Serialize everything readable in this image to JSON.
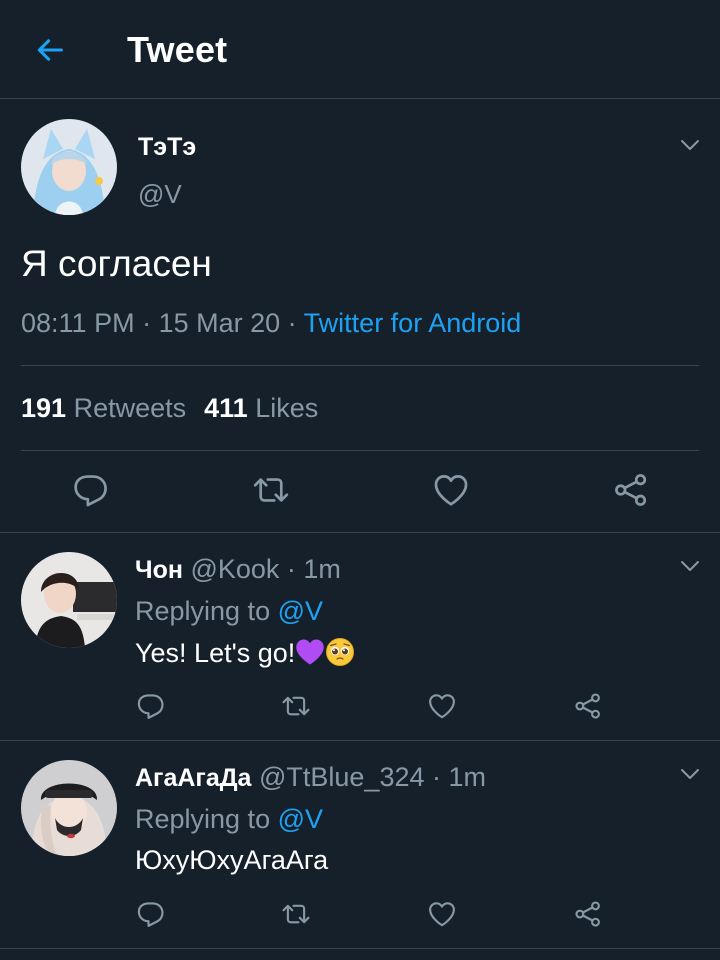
{
  "header": {
    "title": "Tweet"
  },
  "main_tweet": {
    "name": "ТэТэ",
    "handle": "@V",
    "text": "Я согласен",
    "time": "08:11 PM",
    "date": "15 Mar 20",
    "source": "Twitter for Android",
    "retweets_count": "191",
    "retweets_label": "Retweets",
    "likes_count": "411",
    "likes_label": "Likes"
  },
  "replies": [
    {
      "name": "Чон",
      "handle": "@Kook",
      "time": "1m",
      "replying_label": "Replying to",
      "replying_to": "@V",
      "text": "Yes! Let's go!"
    },
    {
      "name": "АгаАгаДа",
      "handle": "@TtBlue_324",
      "time": "1m",
      "replying_label": "Replying to",
      "replying_to": "@V",
      "text": "ЮхуЮхуАгаАга"
    }
  ],
  "separator": " · ",
  "icons": {
    "back": "arrow-left-icon",
    "caret": "chevron-down-icon",
    "reply": "reply-icon",
    "retweet": "retweet-icon",
    "like": "heart-icon",
    "share": "share-icon"
  },
  "colors": {
    "background": "#15202b",
    "accent": "#1da1f2",
    "secondary_text": "#8899a6",
    "divider": "#38444d",
    "heart_emoji": "#b14bf4"
  }
}
